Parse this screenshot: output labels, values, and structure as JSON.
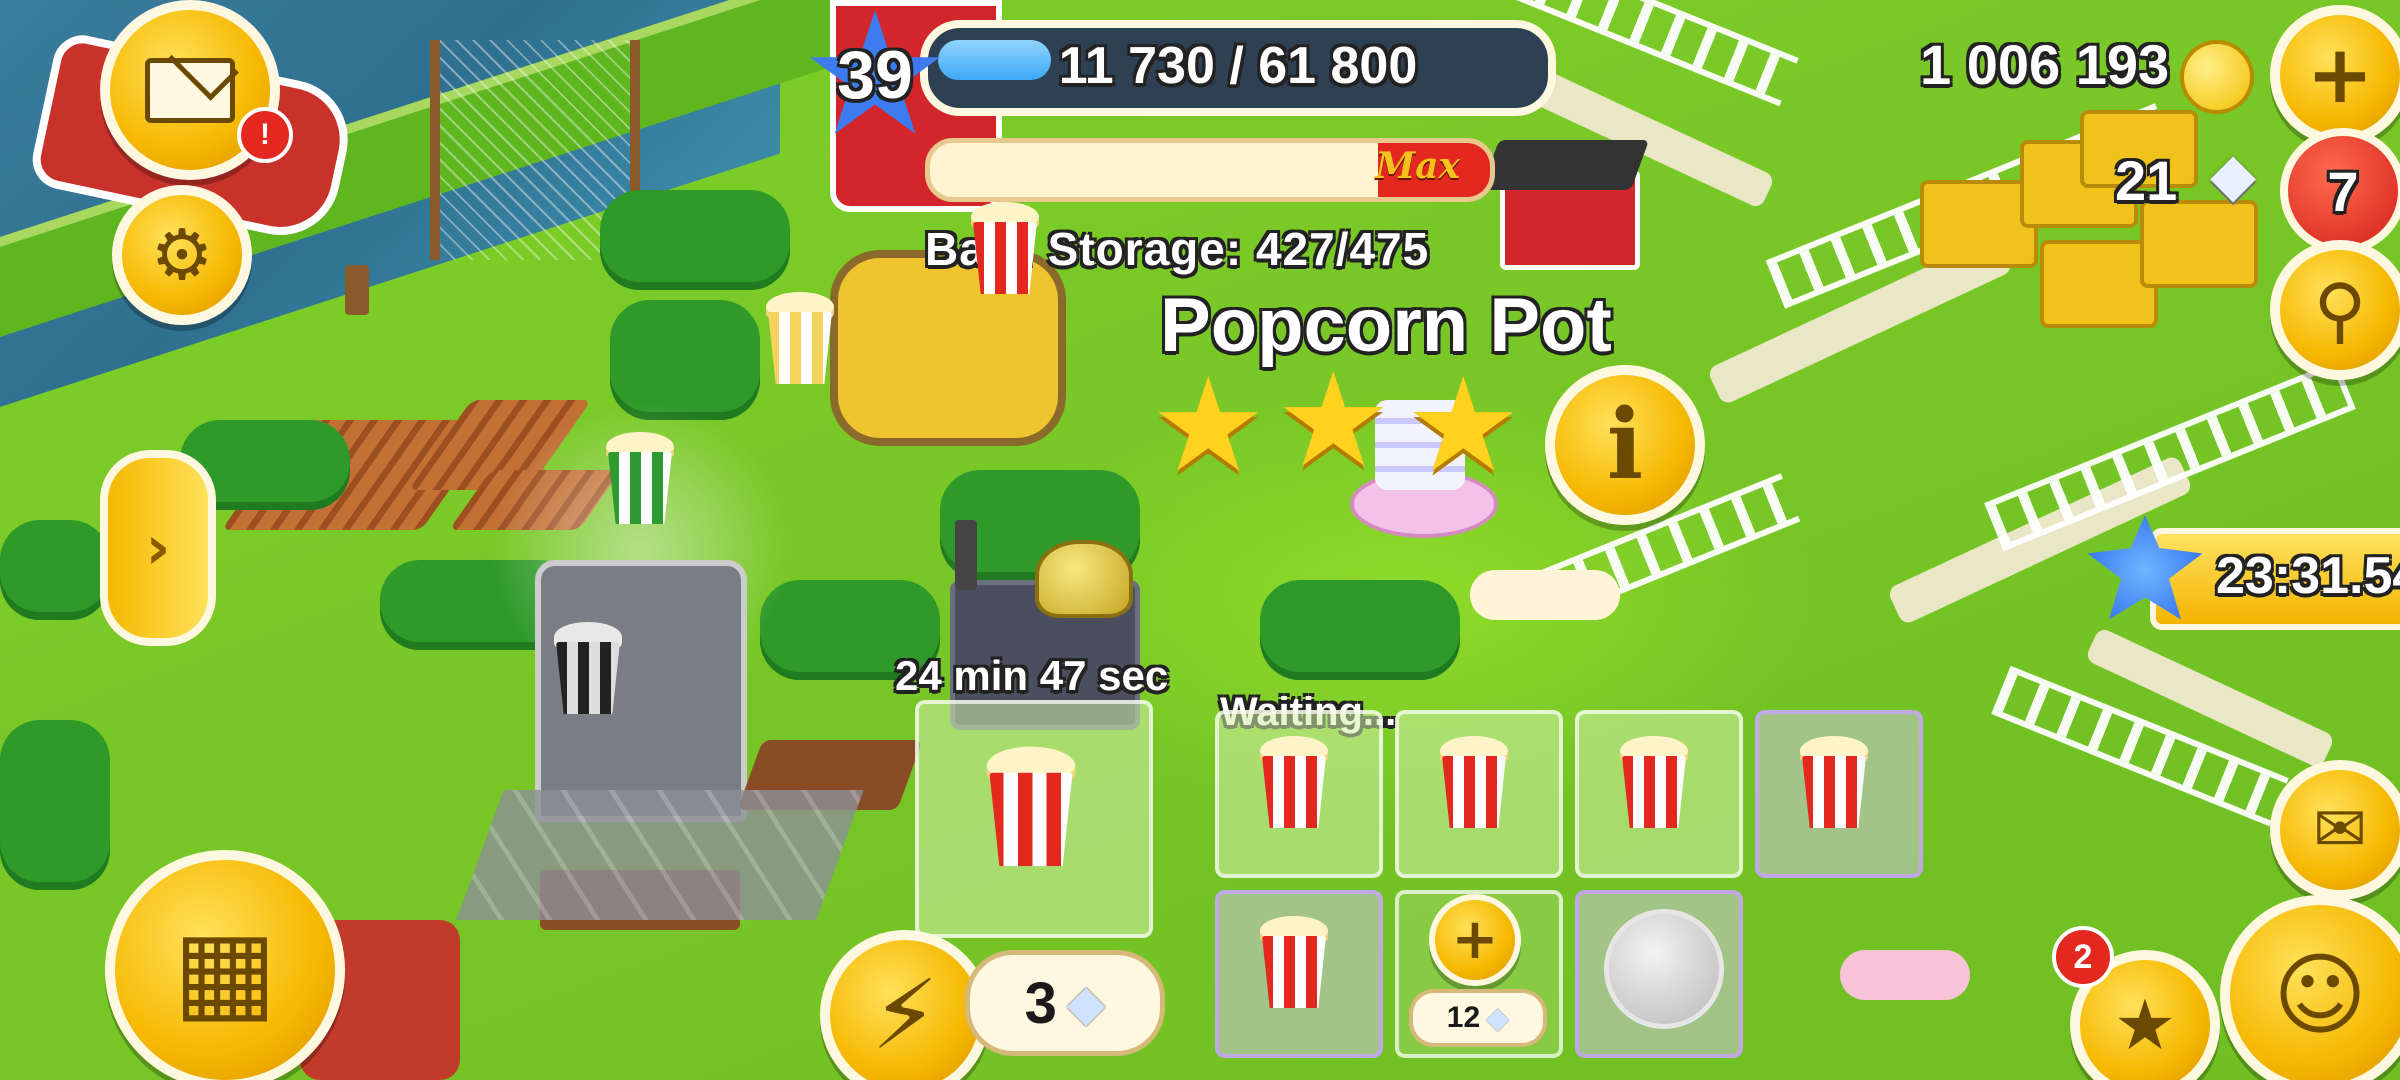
{
  "level": {
    "number": "39",
    "xp_text": "11 730 / 61 800",
    "xp_fraction": 0.19
  },
  "currency": {
    "coins": "1 006 193",
    "diamonds": "21",
    "notification_count": "7"
  },
  "storage": {
    "label": "Barn Storage: 427/475",
    "max_label": "Max",
    "fill_fraction": 0.9
  },
  "machine": {
    "name": "Popcorn Pot",
    "stars": 3
  },
  "production": {
    "timer": "24 min 47 sec",
    "waiting_label": "Waiting...",
    "speedup_cost": "3",
    "unlock_slot_cost": "12"
  },
  "event": {
    "timer": "23:31.54"
  },
  "social": {
    "badge_count": "2"
  },
  "mail": {
    "alert": "!"
  },
  "icons": {
    "mail": "envelope-icon",
    "settings": "gear-icon",
    "expand": "chevron-right-icon",
    "shop": "cash-register-icon",
    "speedup": "lightning-icon",
    "diamond": "diamond-icon",
    "coin": "coin-icon",
    "plus": "plus-icon",
    "search": "magnifier-icon",
    "info": "info-icon",
    "map": "map-icon",
    "friends": "friends-icon",
    "cards": "cards-icon"
  },
  "colors": {
    "button_yellow": "#f6b800",
    "xp_blue": "#3ea8f5",
    "alert_red": "#e2281f",
    "grass": "#79c827"
  }
}
